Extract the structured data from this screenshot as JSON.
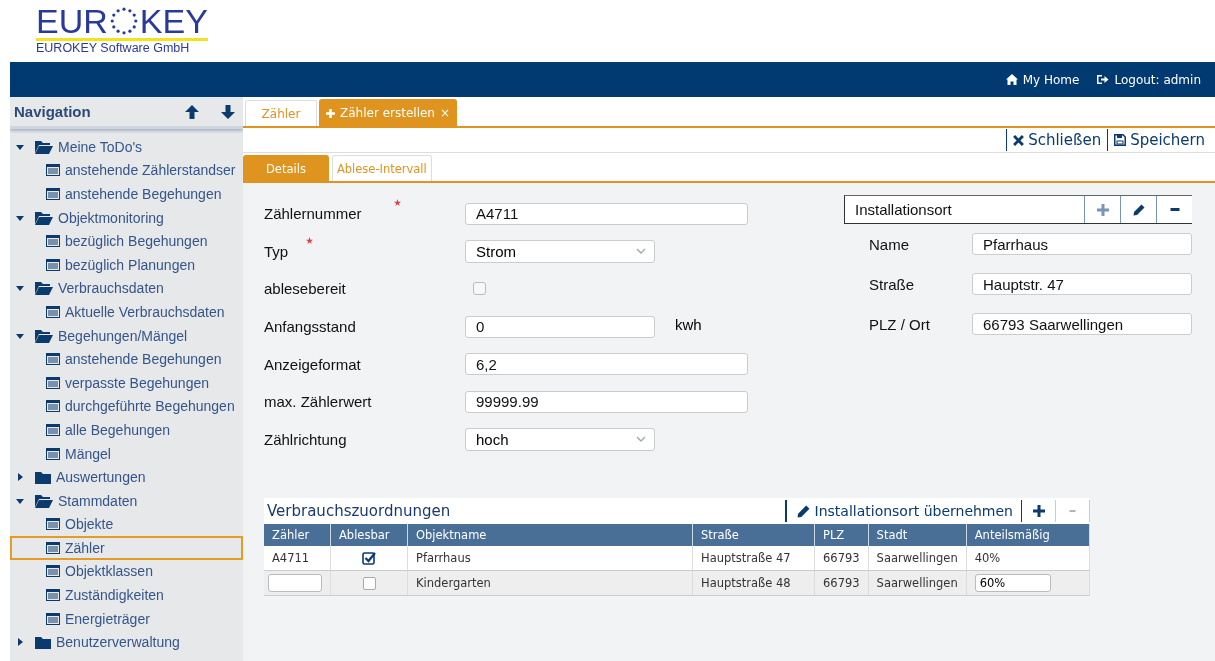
{
  "logo": {
    "wordmark_start": "EUR",
    "wordmark_end": "KEY",
    "subtitle": "EUROKEY Software GmbH"
  },
  "topbar": {
    "links": [
      {
        "label": "My Home",
        "kind": "home"
      },
      {
        "label": "Logout: admin",
        "kind": "logout"
      }
    ]
  },
  "navigation": {
    "title": "Navigation",
    "items": [
      {
        "label": "Meine ToDo's",
        "expanded": true,
        "selected": false,
        "children": [
          {
            "label": "anstehende Zählerstandser",
            "selected": false
          },
          {
            "label": "anstehende Begehungen",
            "selected": false
          }
        ]
      },
      {
        "label": "Objektmonitoring",
        "expanded": true,
        "selected": false,
        "children": [
          {
            "label": "bezüglich Begehungen",
            "selected": false
          },
          {
            "label": "bezüglich Planungen",
            "selected": false
          }
        ]
      },
      {
        "label": "Verbrauchsdaten",
        "expanded": true,
        "selected": false,
        "children": [
          {
            "label": "Aktuelle Verbrauchsdaten",
            "selected": false
          }
        ]
      },
      {
        "label": "Begehungen/Mängel",
        "expanded": true,
        "selected": false,
        "children": [
          {
            "label": "anstehende Begehungen",
            "selected": false
          },
          {
            "label": "verpasste Begehungen",
            "selected": false
          },
          {
            "label": "durchgeführte Begehungen",
            "selected": false
          },
          {
            "label": "alle Begehungen",
            "selected": false
          },
          {
            "label": "Mängel",
            "selected": false
          }
        ]
      },
      {
        "label": "Auswertungen",
        "expanded": false,
        "selected": false
      },
      {
        "label": "Stammdaten",
        "expanded": true,
        "selected": false,
        "children": [
          {
            "label": "Objekte",
            "selected": false
          },
          {
            "label": "Zähler",
            "selected": true
          },
          {
            "label": "Objektklassen",
            "selected": false
          },
          {
            "label": "Zuständigkeiten",
            "selected": false
          },
          {
            "label": "Energieträger",
            "selected": false
          }
        ]
      },
      {
        "label": "Benutzerverwaltung",
        "expanded": false,
        "selected": false
      }
    ]
  },
  "tabs": [
    {
      "label": "Zähler",
      "selected": false
    },
    {
      "label": "Zähler erstellen",
      "selected": true,
      "close": "×"
    }
  ],
  "toolbar": [
    {
      "label": "Schließen",
      "kind": "close"
    },
    {
      "label": "Speichern",
      "kind": "save"
    }
  ],
  "subtabs": [
    {
      "label": "Details",
      "selected": true
    },
    {
      "label": "Ablese-Intervall",
      "selected": false
    }
  ],
  "form": [
    {
      "label": "Zählernummer",
      "kind": "text",
      "required": true,
      "value": "A4711"
    },
    {
      "label": "Typ",
      "kind": "select",
      "required": true,
      "value": "Strom"
    },
    {
      "label": "ablesebereit",
      "kind": "checkbox",
      "required": false,
      "checked": false
    },
    {
      "label": "Anfangsstand",
      "kind": "text",
      "required": false,
      "value": "0",
      "unit": "kwh"
    },
    {
      "label": "Anzeigeformat",
      "kind": "text",
      "required": false,
      "value": "6,2"
    },
    {
      "label": "max. Zählerwert",
      "kind": "text",
      "required": false,
      "value": "99999.99"
    },
    {
      "label": "Zählrichtung",
      "kind": "select",
      "required": false,
      "value": "hoch"
    }
  ],
  "location": {
    "title": "Installationsort",
    "actions": [
      {
        "kind": "plus"
      },
      {
        "kind": "edit"
      },
      {
        "kind": "minus"
      }
    ],
    "fields": [
      {
        "label": "Name",
        "value": "Pfarrhaus"
      },
      {
        "label": "Straße",
        "value": "Hauptstr. 47"
      },
      {
        "label": "PLZ / Ort",
        "value": "66793 Saarwellingen"
      }
    ]
  },
  "allocations": {
    "title": "Verbrauchszuordnungen",
    "apply_button": "Installationsort übernehmen",
    "actions": [
      {
        "kind": "plus"
      },
      {
        "kind": "minus"
      }
    ],
    "columns": [
      "Zähler",
      "Ablesbar",
      "Objektname",
      "Straße",
      "PLZ",
      "Stadt",
      "Anteilsmäßig"
    ],
    "rows": [
      {
        "zaehler": "A4711",
        "ablesbar": true,
        "objektname": "Pfarrhaus",
        "strasse": "Hauptstraße 47",
        "plz": "66793",
        "stadt": "Saarwellingen",
        "anteil": "40%",
        "editing": false
      },
      {
        "ablesbar": false,
        "objektname": "Kindergarten",
        "strasse": "Hauptstraße 48",
        "plz": "66793",
        "stadt": "Saarwellingen",
        "anteil": "60%",
        "editing": true
      }
    ]
  }
}
